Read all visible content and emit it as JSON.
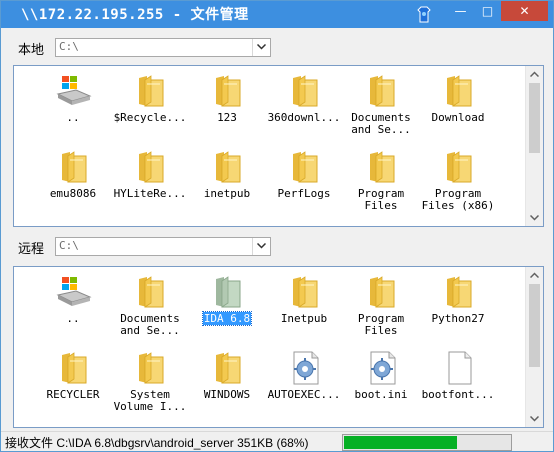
{
  "window": {
    "title": "\\\\172.22.195.255 - 文件管理",
    "minimize_glyph": "—",
    "maximize_glyph": "□",
    "close_glyph": "✕"
  },
  "local": {
    "label": "本地",
    "path": "C:\\",
    "items": [
      {
        "name": "..",
        "icon": "drive-up-icon"
      },
      {
        "name": "$Recycle...",
        "icon": "folder-icon"
      },
      {
        "name": "123",
        "icon": "folder-icon"
      },
      {
        "name": "360downl...",
        "icon": "folder-icon"
      },
      {
        "name": "Documents\nand Se...",
        "icon": "folder-icon"
      },
      {
        "name": "Download",
        "icon": "folder-icon"
      },
      {
        "name": "emu8086",
        "icon": "folder-icon"
      },
      {
        "name": "HYLiteRe...",
        "icon": "folder-icon"
      },
      {
        "name": "inetpub",
        "icon": "folder-icon"
      },
      {
        "name": "PerfLogs",
        "icon": "folder-icon"
      },
      {
        "name": "Program\nFiles",
        "icon": "folder-icon"
      },
      {
        "name": "Program\nFiles (x86)",
        "icon": "folder-icon"
      }
    ],
    "scroll_thumb_fraction": 0.55
  },
  "remote": {
    "label": "远程",
    "path": "C:\\",
    "items": [
      {
        "name": "..",
        "icon": "drive-up-icon"
      },
      {
        "name": "Documents\nand Se...",
        "icon": "folder-icon"
      },
      {
        "name": "IDA 6.8",
        "icon": "folder-selected-icon",
        "selected": true
      },
      {
        "name": "Inetpub",
        "icon": "folder-icon"
      },
      {
        "name": "Program\nFiles",
        "icon": "folder-icon"
      },
      {
        "name": "Python27",
        "icon": "folder-icon"
      },
      {
        "name": "RECYCLER",
        "icon": "folder-icon"
      },
      {
        "name": "System\nVolume I...",
        "icon": "folder-icon"
      },
      {
        "name": "WINDOWS",
        "icon": "folder-icon"
      },
      {
        "name": "AUTOEXEC...",
        "icon": "settings-file-icon"
      },
      {
        "name": "boot.ini",
        "icon": "settings-file-icon"
      },
      {
        "name": "bootfont...",
        "icon": "blank-file-icon"
      }
    ],
    "scroll_thumb_fraction": 0.65
  },
  "status": {
    "text": "接收文件 C:\\IDA 6.8\\dbgsrv\\android_server 351KB (68%)",
    "progress": 0.68
  },
  "colors": {
    "titlebar": "#3d8fe0",
    "close": "#c7493a",
    "progress": "#06b025",
    "selection": "#3399ff"
  }
}
